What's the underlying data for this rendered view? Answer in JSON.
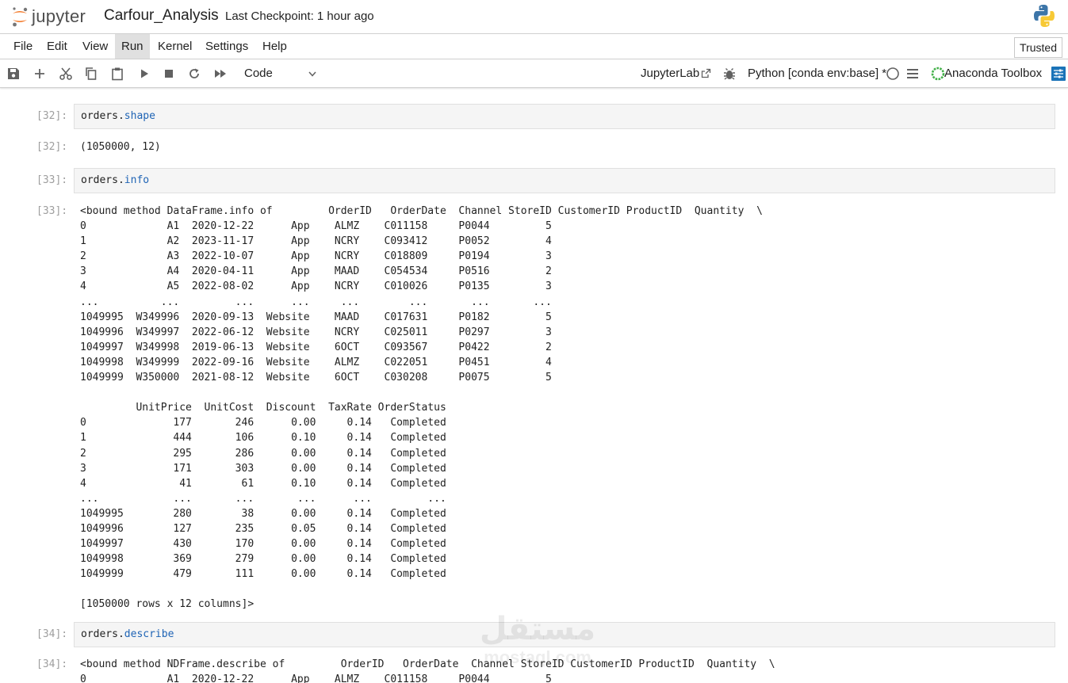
{
  "header": {
    "logo_text": "jupyter",
    "notebook_title": "Carfour_Analysis",
    "checkpoint": "Last Checkpoint: 1 hour ago"
  },
  "menu": {
    "items": [
      "File",
      "Edit",
      "View",
      "Run",
      "Kernel",
      "Settings",
      "Help"
    ],
    "active": "Run",
    "trusted": "Trusted"
  },
  "toolbar": {
    "icons": [
      "save-icon",
      "add-cell-icon",
      "cut-icon",
      "copy-icon",
      "paste-icon",
      "run-icon",
      "stop-icon",
      "restart-icon",
      "fast-forward-icon"
    ],
    "cell_type": "Code",
    "jupyterlab": "JupyterLab",
    "kernel": "Python [conda env:base] *",
    "anaconda": "Anaconda Toolbox"
  },
  "cells": [
    {
      "prompt_in": "[32]:",
      "obj": "orders.",
      "attr": "shape",
      "prompt_out": "[32]:",
      "output": "(1050000, 12)"
    },
    {
      "prompt_in": "[33]:",
      "obj": "orders.",
      "attr": "info",
      "prompt_out": "[33]:",
      "output": "<bound method DataFrame.info of         OrderID   OrderDate  Channel StoreID CustomerID ProductID  Quantity  \\\n0             A1  2020-12-22      App    ALMZ    C011158     P0044         5\n1             A2  2023-11-17      App    NCRY    C093412     P0052         4\n2             A3  2022-10-07      App    NCRY    C018809     P0194         3\n3             A4  2020-04-11      App    MAAD    C054534     P0516         2\n4             A5  2022-08-02      App    NCRY    C010026     P0135         3\n...          ...         ...      ...     ...        ...       ...       ...\n1049995  W349996  2020-09-13  Website    MAAD    C017631     P0182         5\n1049996  W349997  2022-06-12  Website    NCRY    C025011     P0297         3\n1049997  W349998  2019-06-13  Website    6OCT    C093567     P0422         2\n1049998  W349999  2022-09-16  Website    ALMZ    C022051     P0451         4\n1049999  W350000  2021-08-12  Website    6OCT    C030208     P0075         5\n\n         UnitPrice  UnitCost  Discount  TaxRate OrderStatus\n0              177       246      0.00     0.14   Completed\n1              444       106      0.10     0.14   Completed\n2              295       286      0.00     0.14   Completed\n3              171       303      0.00     0.14   Completed\n4               41        61      0.10     0.14   Completed\n...            ...       ...       ...      ...         ...\n1049995        280        38      0.00     0.14   Completed\n1049996        127       235      0.05     0.14   Completed\n1049997        430       170      0.00     0.14   Completed\n1049998        369       279      0.00     0.14   Completed\n1049999        479       111      0.00     0.14   Completed\n\n[1050000 rows x 12 columns]>"
    },
    {
      "prompt_in": "[34]:",
      "obj": "orders.",
      "attr": "describe",
      "prompt_out": "[34]:",
      "output": "<bound method NDFrame.describe of         OrderID   OrderDate  Channel StoreID CustomerID ProductID  Quantity  \\\n0             A1  2020-12-22      App    ALMZ    C011158     P0044         5"
    }
  ],
  "watermark": {
    "arabic": "مستقل",
    "latin": "mostaql.com"
  },
  "colors": {
    "jupyter_orange": "#f37726",
    "attr_blue": "#1f64b5",
    "prompt_gray": "#9e9e9e",
    "cell_bg": "#f5f5f5",
    "anaconda_green": "#43b049",
    "toolbox_blue": "#1a73b8"
  }
}
